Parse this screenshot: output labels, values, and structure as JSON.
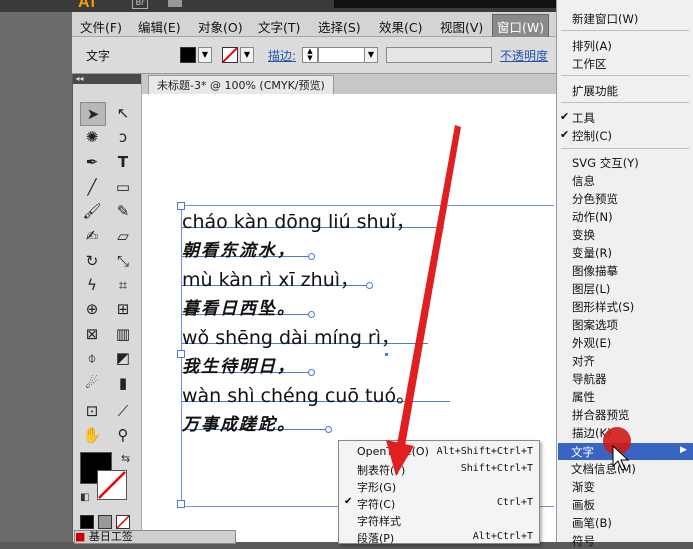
{
  "app": {
    "logo": "Ai",
    "br_badge": "Br"
  },
  "menubar": [
    "文件(F)",
    "编辑(E)",
    "对象(O)",
    "文字(T)",
    "选择(S)",
    "效果(C)",
    "视图(V)",
    "窗口(W)"
  ],
  "controlbar": {
    "label": "文字",
    "stroke_label": "描边:",
    "opacity_label": "不透明度"
  },
  "document": {
    "tab_title": "未标题-3* @ 100% (CMYK/预览)"
  },
  "canvas_text": {
    "l1": "cháo kàn dōng liú shuǐ，",
    "l2": "朝看东流水，",
    "l3": "mù kàn rì xī zhuì，",
    "l4": "暮看日西坠。",
    "l5": "wǒ shēng dài míng rì，",
    "l6": "我生待明日，",
    "l7": "wàn shì chéng cuō tuó。",
    "l8": "万事成蹉跎。"
  },
  "window_menu": [
    "新建窗口(W)",
    "排列(A)",
    "工作区",
    "扩展功能",
    "工具",
    "控制(C)",
    "SVG 交互(Y)",
    "信息",
    "分色预览",
    "动作(N)",
    "变换",
    "变量(R)",
    "图像描摹",
    "图层(L)",
    "图形样式(S)",
    "图案选项",
    "外观(E)",
    "对齐",
    "导航器",
    "属性",
    "拼合器预览",
    "描边(K)",
    "文字",
    "文档信息(M)",
    "渐变",
    "画板",
    "画笔(B)",
    "符号"
  ],
  "type_submenu": [
    {
      "label": "OpenType(O)",
      "shortcut": "Alt+Shift+Ctrl+T"
    },
    {
      "label": "制表符(T)",
      "shortcut": "Shift+Ctrl+T"
    },
    {
      "label": "字形(G)",
      "shortcut": ""
    },
    {
      "label": "字符(C)",
      "shortcut": "Ctrl+T"
    },
    {
      "label": "字符样式",
      "shortcut": ""
    },
    {
      "label": "段落(P)",
      "shortcut": "Alt+Ctrl+T"
    }
  ],
  "bottom_panel": {
    "label": "基日工签"
  },
  "colors": {
    "highlight": "#3a64c4",
    "arrow": "#e02020",
    "baseline": "#4a7bd0",
    "logo": "#ff9a00"
  }
}
